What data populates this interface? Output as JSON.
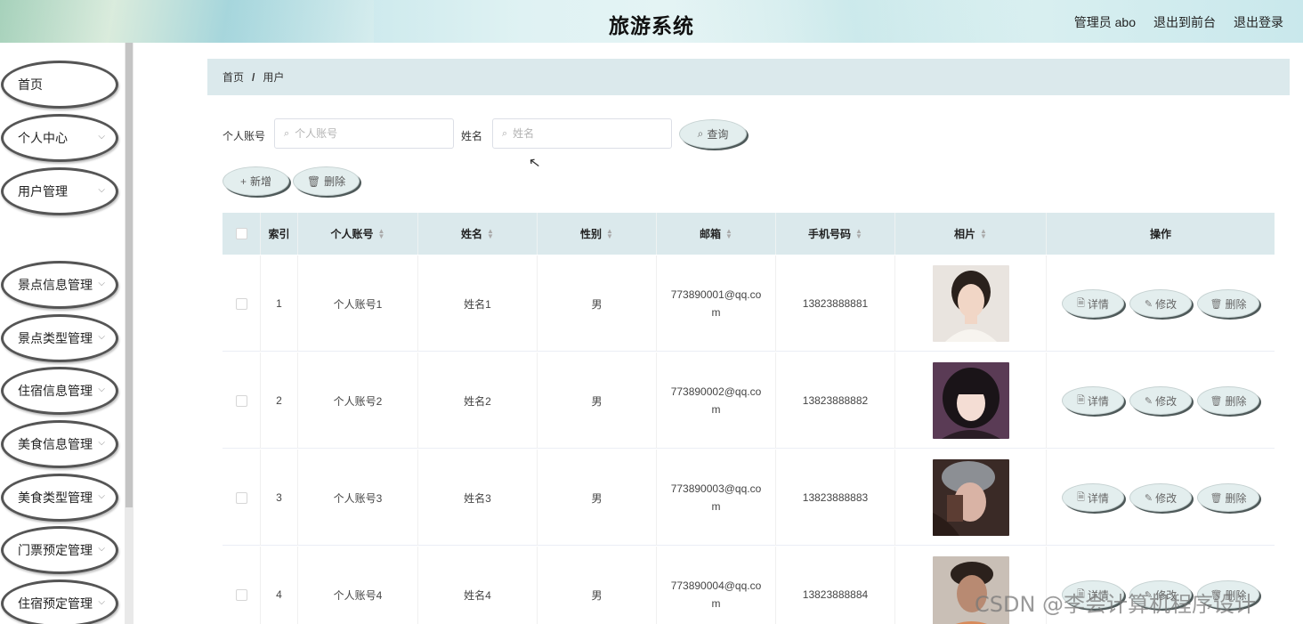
{
  "header": {
    "title": "旅游系统",
    "admin_label": "管理员 abo",
    "back_to_front": "退出到前台",
    "logout": "退出登录"
  },
  "sidebar": {
    "items": [
      {
        "label": "首页",
        "has_chevron": false
      },
      {
        "label": "个人中心",
        "has_chevron": true
      },
      {
        "label": "用户管理",
        "has_chevron": true
      },
      {
        "label": "景点信息管理",
        "has_chevron": true
      },
      {
        "label": "景点类型管理",
        "has_chevron": true
      },
      {
        "label": "住宿信息管理",
        "has_chevron": true
      },
      {
        "label": "美食信息管理",
        "has_chevron": true
      },
      {
        "label": "美食类型管理",
        "has_chevron": true
      },
      {
        "label": "门票预定管理",
        "has_chevron": true
      },
      {
        "label": "住宿预定管理",
        "has_chevron": true
      }
    ],
    "submenu": {
      "label": "用户"
    }
  },
  "breadcrumb": {
    "home": "首页",
    "separator": "/",
    "current": "用户"
  },
  "search": {
    "account_label": "个人账号",
    "account_placeholder": "个人账号",
    "name_label": "姓名",
    "name_placeholder": "姓名",
    "query_button": "查询"
  },
  "actions": {
    "add_button": "新增",
    "delete_button": "删除"
  },
  "table": {
    "columns": [
      "索引",
      "个人账号",
      "姓名",
      "性别",
      "邮箱",
      "手机号码",
      "相片",
      "操作"
    ],
    "rows": [
      {
        "index": "1",
        "account": "个人账号1",
        "name": "姓名1",
        "gender": "男",
        "email": "773890001@qq.com",
        "phone": "13823888881"
      },
      {
        "index": "2",
        "account": "个人账号2",
        "name": "姓名2",
        "gender": "男",
        "email": "773890002@qq.com",
        "phone": "13823888882"
      },
      {
        "index": "3",
        "account": "个人账号3",
        "name": "姓名3",
        "gender": "男",
        "email": "773890003@qq.com",
        "phone": "13823888883"
      },
      {
        "index": "4",
        "account": "个人账号4",
        "name": "姓名4",
        "gender": "男",
        "email": "773890004@qq.com",
        "phone": "13823888884"
      }
    ],
    "row_actions": {
      "detail": "详情",
      "edit": "修改",
      "delete": "删除"
    }
  },
  "watermark": "CSDN @李会计算机程序设计",
  "colors": {
    "header_bg": "#d8eff0",
    "breadcrumb_bg": "#dbe9ec",
    "table_header_bg": "#dbe9ec",
    "button_bg": "#e3eeee",
    "button_shadow": "#4f5a5a"
  }
}
